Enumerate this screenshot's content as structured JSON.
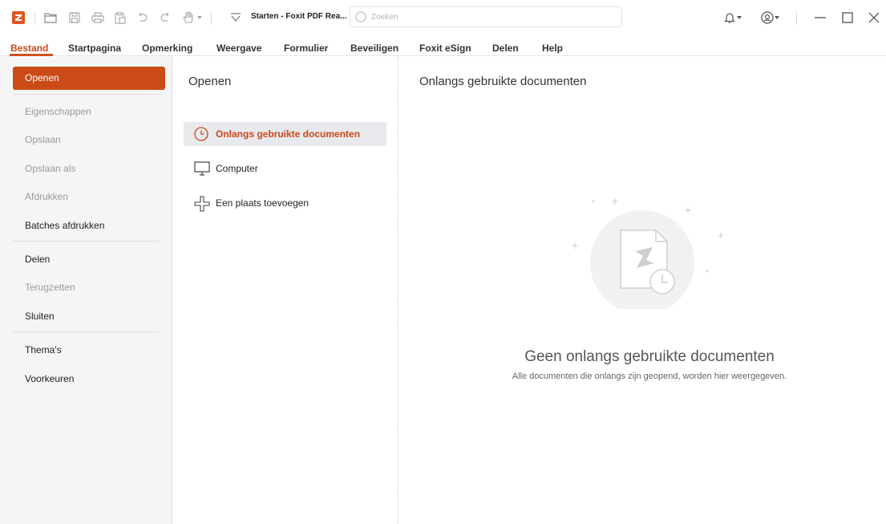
{
  "titlebar": {
    "doc_title": "Starten - Foxit PDF Rea...",
    "search_placeholder": "Zoeken"
  },
  "menu": {
    "items": [
      "Bestand",
      "Startpagina",
      "Opmerking",
      "Weergave",
      "Formulier",
      "Beveiligen",
      "Foxit eSign",
      "Delen",
      "Help"
    ],
    "active": "Bestand"
  },
  "sidebar": {
    "open_label": "Openen",
    "items": [
      {
        "label": "Eigenschappen",
        "enabled": false
      },
      {
        "label": "Opslaan",
        "enabled": false
      },
      {
        "label": "Opslaan als",
        "enabled": false
      },
      {
        "label": "Afdrukken",
        "enabled": false
      },
      {
        "label": "Batches afdrukken",
        "enabled": true
      },
      {
        "label": "Delen",
        "enabled": true
      },
      {
        "label": "Terugzetten",
        "enabled": false
      },
      {
        "label": "Sluiten",
        "enabled": true
      },
      {
        "label": "Thema's",
        "enabled": true
      },
      {
        "label": "Voorkeuren",
        "enabled": true
      }
    ]
  },
  "open_panel": {
    "title": "Openen",
    "options": [
      {
        "label": "Onlangs gebruikte documenten",
        "icon": "clock-icon",
        "selected": true
      },
      {
        "label": "Computer",
        "icon": "monitor-icon",
        "selected": false
      },
      {
        "label": "Een plaats toevoegen",
        "icon": "add-place-icon",
        "selected": false
      }
    ]
  },
  "recent_panel": {
    "title": "Onlangs gebruikte documenten",
    "empty_title": "Geen onlangs gebruikte documenten",
    "empty_subtitle": "Alle documenten die onlangs zijn geopend, worden hier weergegeven."
  },
  "colors": {
    "accent": "#cb4b16",
    "accent_text": "#c9491a",
    "sidebar_bg": "#f5f5f5",
    "selected_bg": "#e8e9ed"
  }
}
